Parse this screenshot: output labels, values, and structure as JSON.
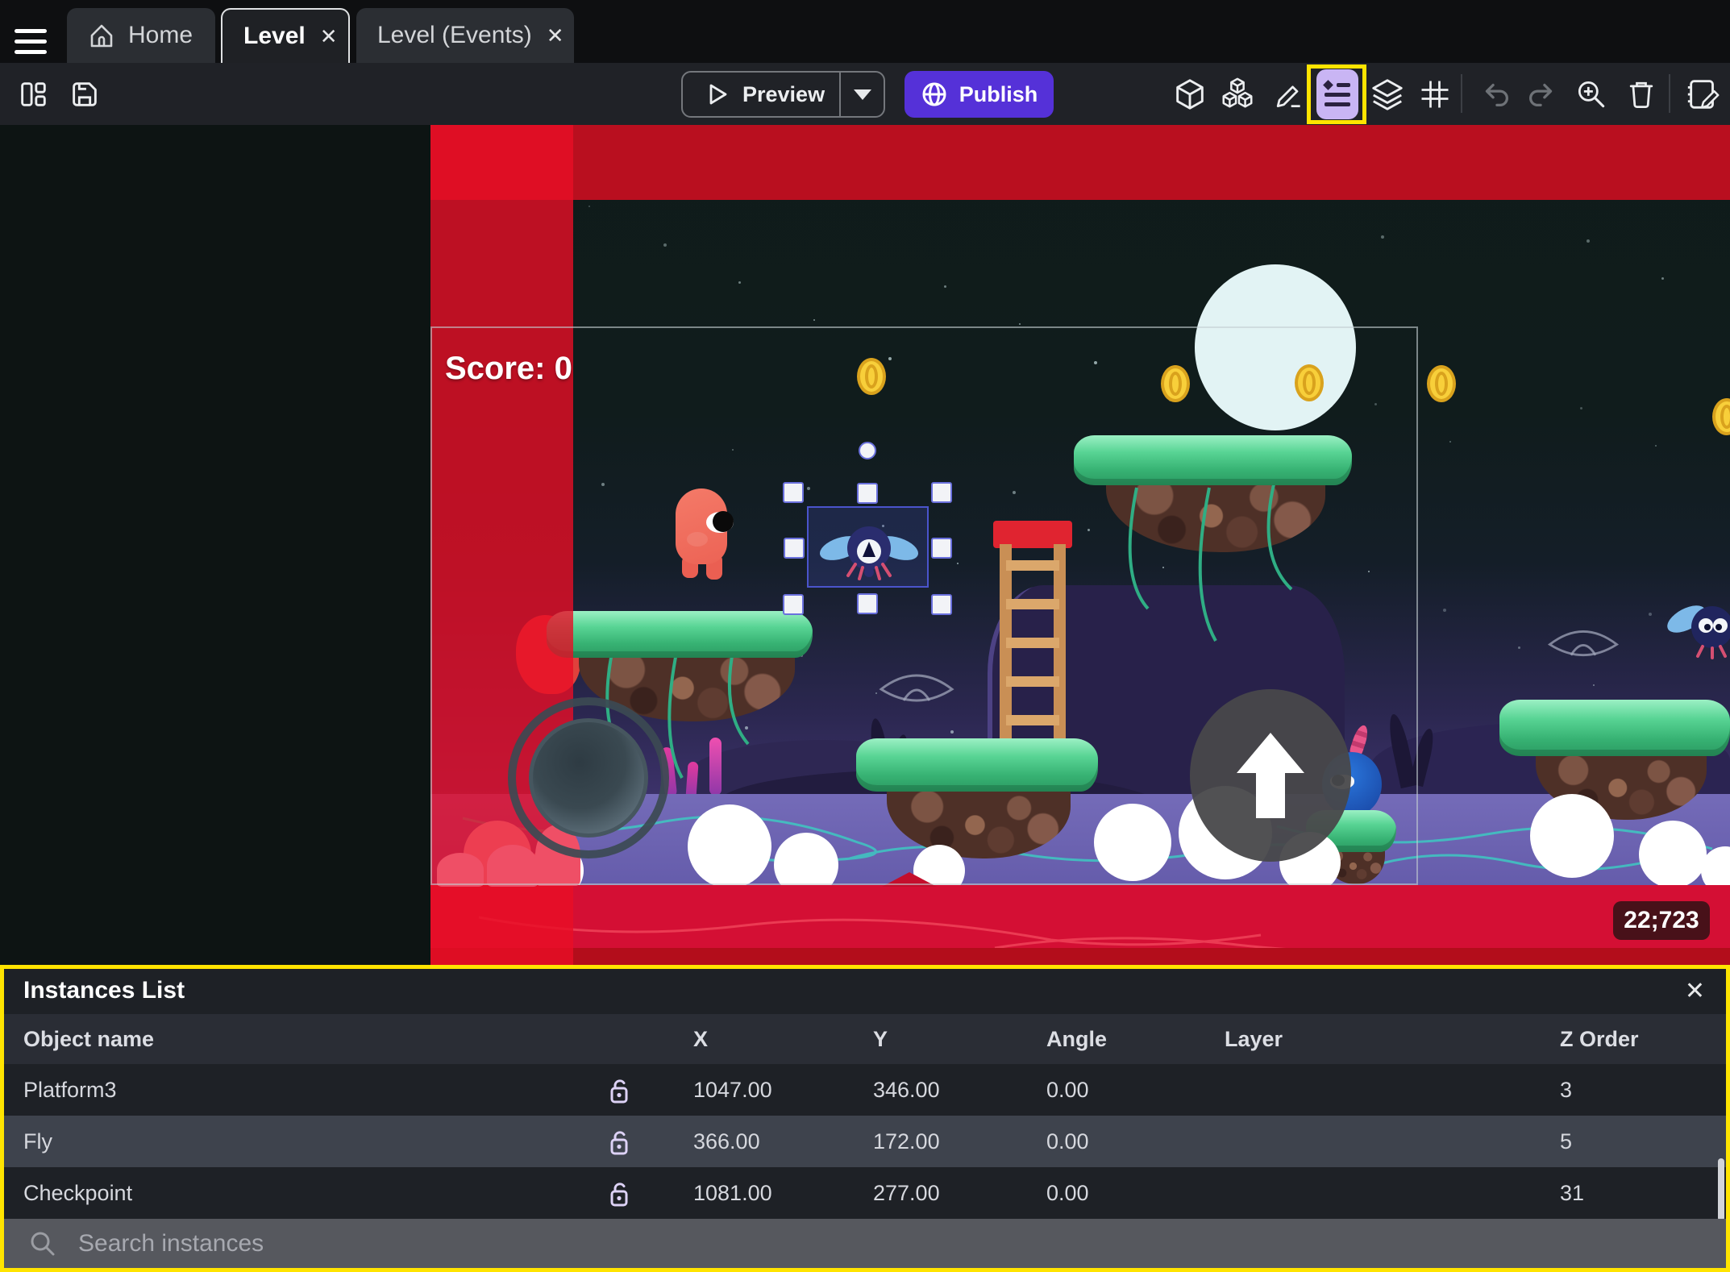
{
  "icons": {
    "close": "✕"
  },
  "tabbar": {
    "tabs": [
      {
        "label": "Home"
      },
      {
        "label": "Level"
      },
      {
        "label": "Level (Events)"
      }
    ]
  },
  "toolbar": {
    "preview_label": "Preview",
    "publish_label": "Publish"
  },
  "scene": {
    "score_text": "Score: 0",
    "coords_badge": "22;723"
  },
  "colors": {
    "publish_purple": "#5531d8",
    "highlight_yellow": "#ffe400",
    "selection_blue": "#4a54cc",
    "red_band": "#b90f1f"
  },
  "panel": {
    "title": "Instances List",
    "columns": [
      "Object name",
      "X",
      "Y",
      "Angle",
      "Layer",
      "Z Order"
    ],
    "rows": [
      {
        "name": "Platform3",
        "x": "1047.00",
        "y": "346.00",
        "angle": "0.00",
        "layer": "",
        "z_order": "3"
      },
      {
        "name": "Fly",
        "x": "366.00",
        "y": "172.00",
        "angle": "0.00",
        "layer": "",
        "z_order": "5"
      },
      {
        "name": "Checkpoint",
        "x": "1081.00",
        "y": "277.00",
        "angle": "0.00",
        "layer": "",
        "z_order": "31"
      }
    ],
    "search_placeholder": "Search instances"
  }
}
